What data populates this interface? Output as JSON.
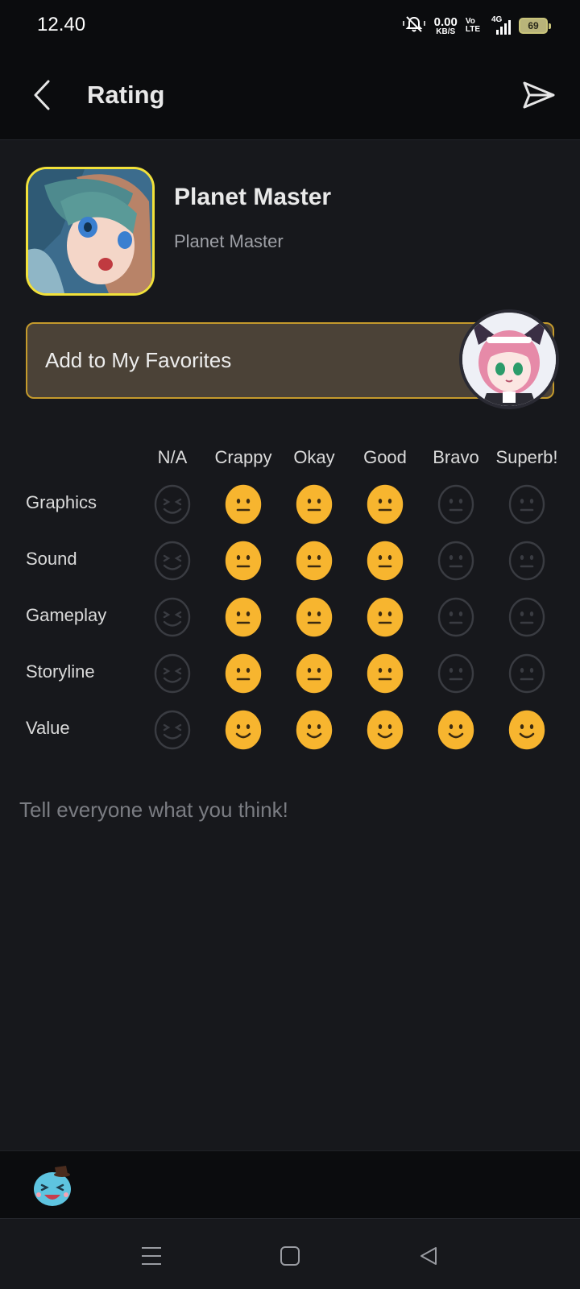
{
  "status_bar": {
    "time": "12.40",
    "net_speed_value": "0.00",
    "net_speed_unit": "KB/S",
    "volte_line1": "Vo",
    "volte_line2": "LTE",
    "network": "4G",
    "battery": "69"
  },
  "header": {
    "title": "Rating",
    "back_icon": "chevron-left-icon",
    "send_icon": "send-icon"
  },
  "game": {
    "title": "Planet Master",
    "subtitle": "Planet Master"
  },
  "favorites": {
    "label": "Add to My Favorites"
  },
  "rating": {
    "columns": [
      "N/A",
      "Crappy",
      "Okay",
      "Good",
      "Bravo",
      "Superb!"
    ],
    "rows": [
      {
        "label": "Graphics",
        "selected": "Good"
      },
      {
        "label": "Sound",
        "selected": "Good"
      },
      {
        "label": "Gameplay",
        "selected": "Good"
      },
      {
        "label": "Storyline",
        "selected": "Good"
      },
      {
        "label": "Value",
        "selected": "Superb!"
      }
    ]
  },
  "comment": {
    "placeholder": "Tell everyone what you think!",
    "value": ""
  },
  "colors": {
    "accent": "#f7b52f",
    "accent_border": "#c49a2c",
    "inactive_face": "#3a3c42",
    "background": "#17181c"
  }
}
